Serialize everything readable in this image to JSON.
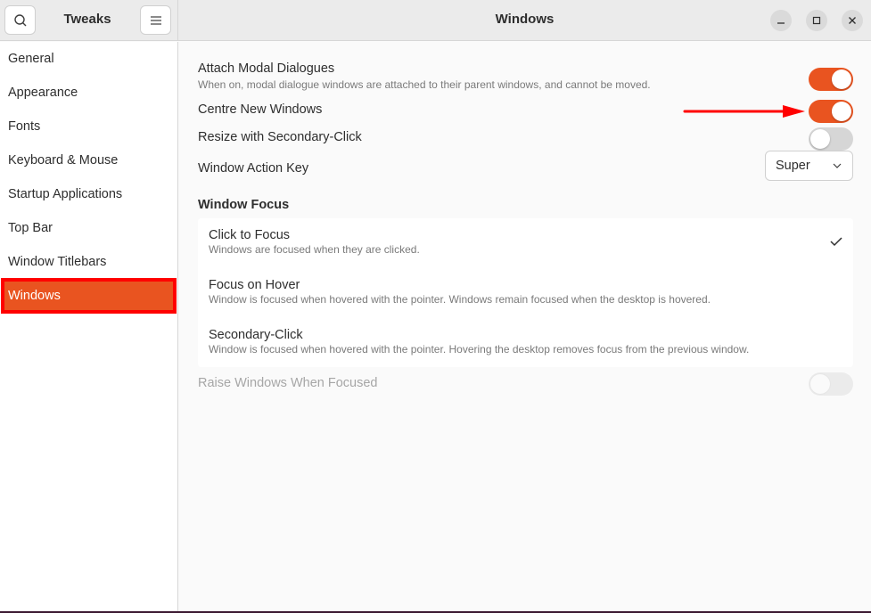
{
  "header": {
    "app_title": "Tweaks",
    "page_title": "Windows",
    "search_icon": "search-icon",
    "menu_icon": "hamburger-menu-icon",
    "window_controls": [
      "minimize-icon",
      "maximize-icon",
      "close-icon"
    ]
  },
  "sidebar": {
    "items": [
      {
        "label": "General",
        "active": false
      },
      {
        "label": "Appearance",
        "active": false
      },
      {
        "label": "Fonts",
        "active": false
      },
      {
        "label": "Keyboard & Mouse",
        "active": false
      },
      {
        "label": "Startup Applications",
        "active": false
      },
      {
        "label": "Top Bar",
        "active": false
      },
      {
        "label": "Window Titlebars",
        "active": false
      },
      {
        "label": "Windows",
        "active": true
      }
    ]
  },
  "settings": {
    "attach_modal": {
      "title": "Attach Modal Dialogues",
      "subtitle": "When on, modal dialogue windows are attached to their parent windows, and cannot be moved.",
      "enabled": true
    },
    "centre_new": {
      "title": "Centre New Windows",
      "enabled": true
    },
    "resize_secondary": {
      "title": "Resize with Secondary-Click",
      "enabled": false
    },
    "action_key": {
      "title": "Window Action Key",
      "value": "Super"
    }
  },
  "window_focus": {
    "section_title": "Window Focus",
    "options": [
      {
        "title": "Click to Focus",
        "subtitle": "Windows are focused when they are clicked.",
        "selected": true
      },
      {
        "title": "Focus on Hover",
        "subtitle": "Window is focused when hovered with the pointer. Windows remain focused when the desktop is hovered.",
        "selected": false
      },
      {
        "title": "Secondary-Click",
        "subtitle": "Window is focused when hovered with the pointer. Hovering the desktop removes focus from the previous window.",
        "selected": false
      }
    ],
    "raise_windows": {
      "title": "Raise Windows When Focused",
      "enabled": false,
      "disabled": true
    }
  },
  "colors": {
    "accent": "#e95420",
    "annotation": "#ff0000"
  }
}
